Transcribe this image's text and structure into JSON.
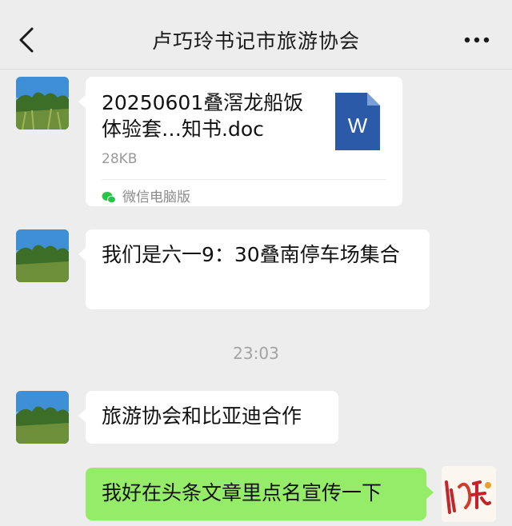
{
  "header": {
    "title": "卢巧玲书记市旅游协会",
    "back_icon": "chevron-left-icon",
    "more_icon": "more-horizontal-icon"
  },
  "messages": [
    {
      "type": "file",
      "sender": "other",
      "file_name": "20250601叠滘龙船饭体验套…知书.doc",
      "file_size": "28KB",
      "file_type_letter": "W",
      "source": "微信电脑版"
    },
    {
      "type": "text",
      "sender": "other",
      "text": "我们是六一9：30叠南停车场集合"
    },
    {
      "type": "time",
      "text": "23:03"
    },
    {
      "type": "text",
      "sender": "other",
      "text": "旅游协会和比亚迪合作"
    },
    {
      "type": "text",
      "sender": "me",
      "text": "我好在头条文章里点名宣传一下"
    }
  ],
  "colors": {
    "background": "#ededed",
    "bubble_other": "#ffffff",
    "bubble_me": "#95ec69",
    "word_icon": "#2b5aa8",
    "time_text": "#a3a3a3"
  }
}
